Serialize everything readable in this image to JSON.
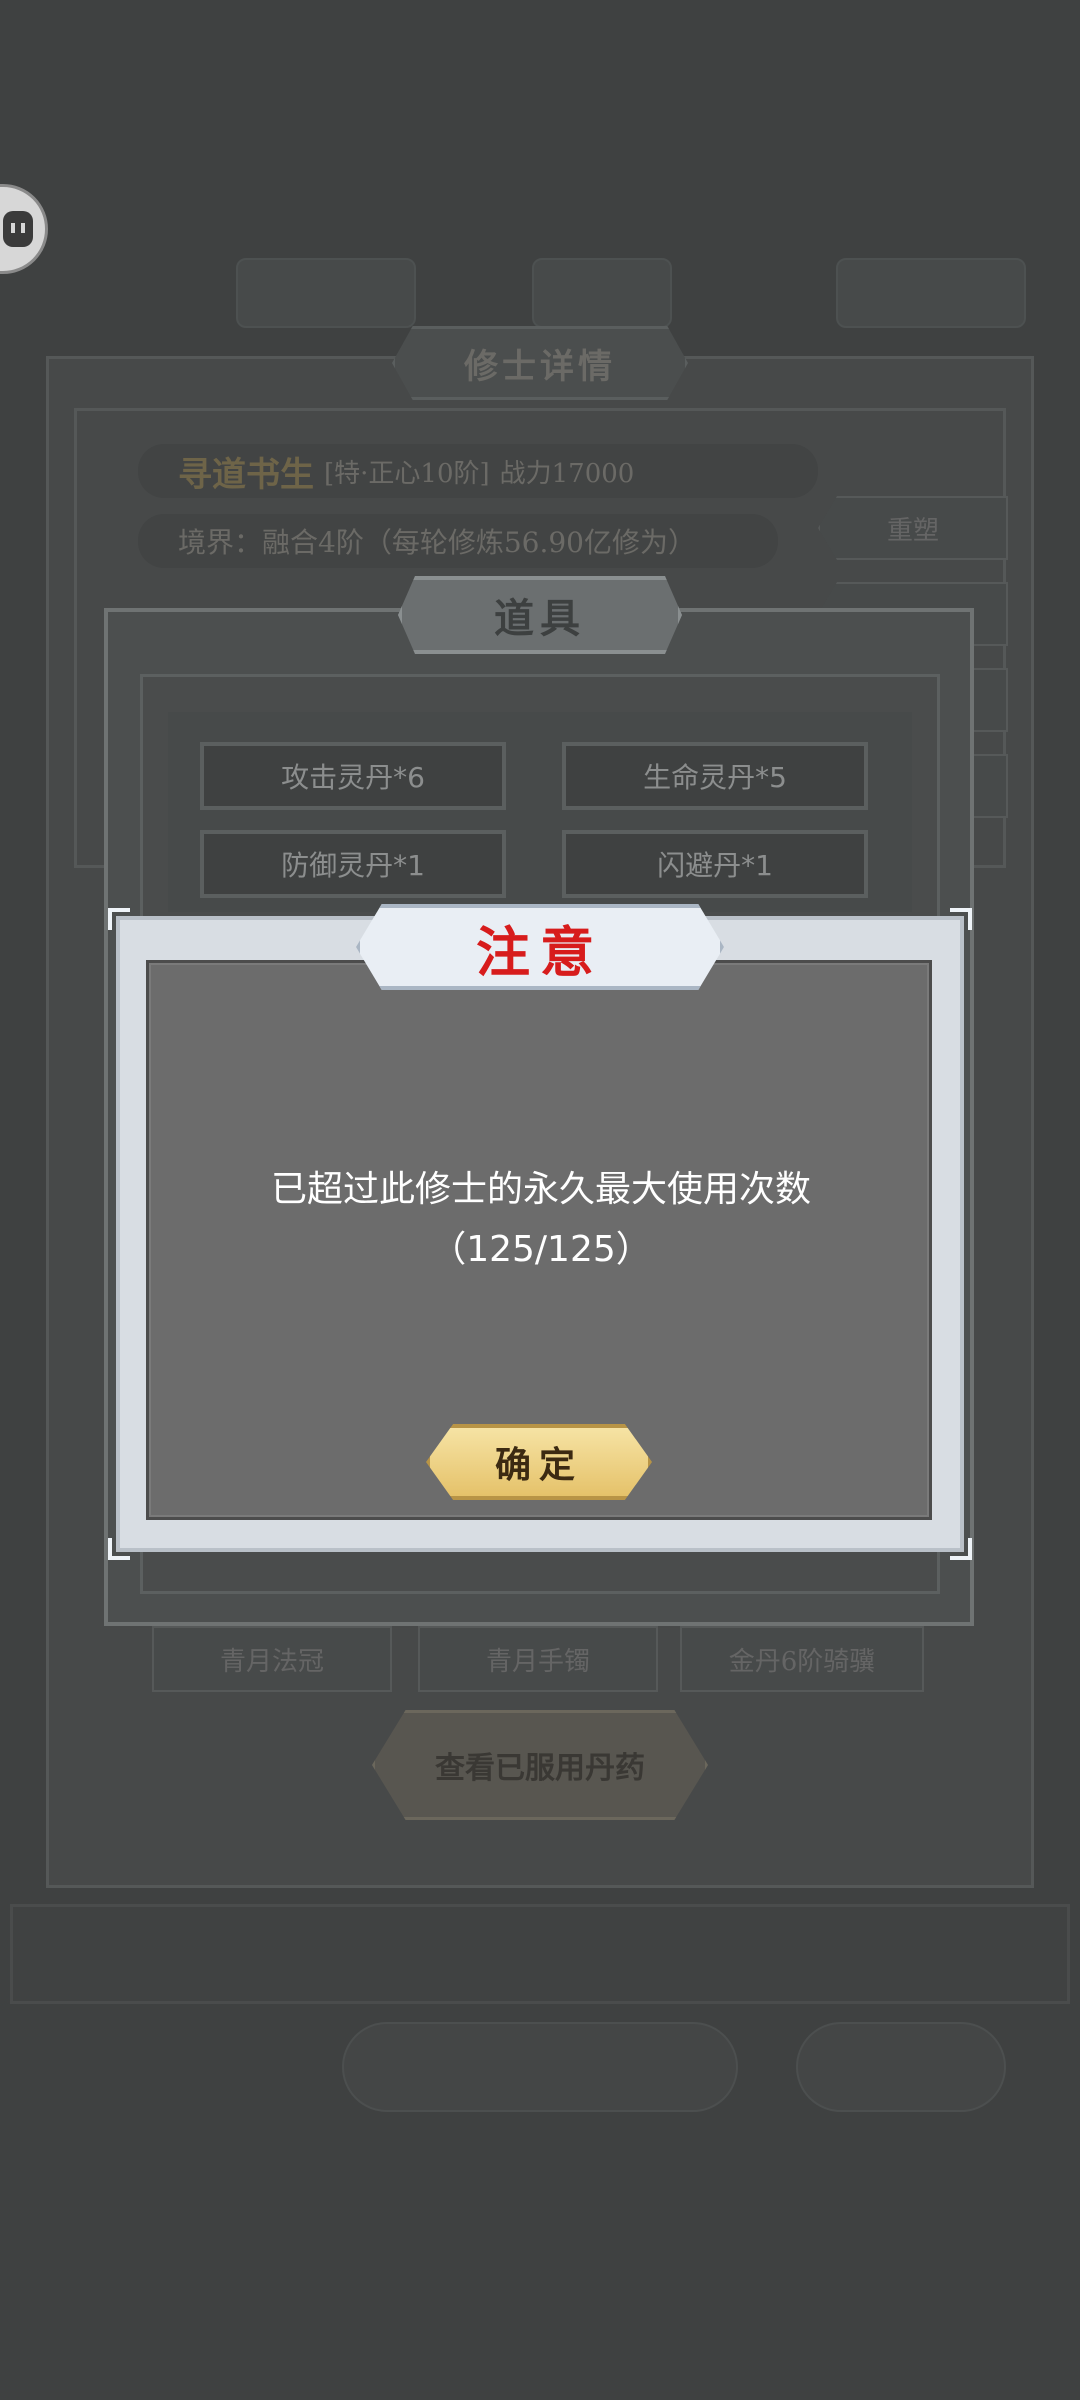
{
  "background": {
    "header_title": "修士详情",
    "cultivator_name": "寻道书生",
    "cultivator_tag": "[特·正心10阶]",
    "power_label": "战力17000",
    "realm_text": "境界：融合4阶（每轮修炼56.90亿修为）",
    "side_button": "重塑",
    "bottom_tabs": [
      "青月法冠",
      "青月手镯",
      "金丹6阶骑骥"
    ],
    "view_pills_button": "查看已服用丹药"
  },
  "items_panel": {
    "title": "道具",
    "items": [
      {
        "label": "攻击灵丹*6"
      },
      {
        "label": "生命灵丹*5"
      },
      {
        "label": "防御灵丹*1"
      },
      {
        "label": "闪避丹*1"
      }
    ]
  },
  "alert": {
    "title": "注意",
    "message": "已超过此修士的永久最大使用次数（125/125）",
    "confirm_label": "确定"
  },
  "colors": {
    "alert_title": "#d71c1c",
    "confirm_button": "#f2dd9a",
    "dim_background": "#3f4141"
  }
}
